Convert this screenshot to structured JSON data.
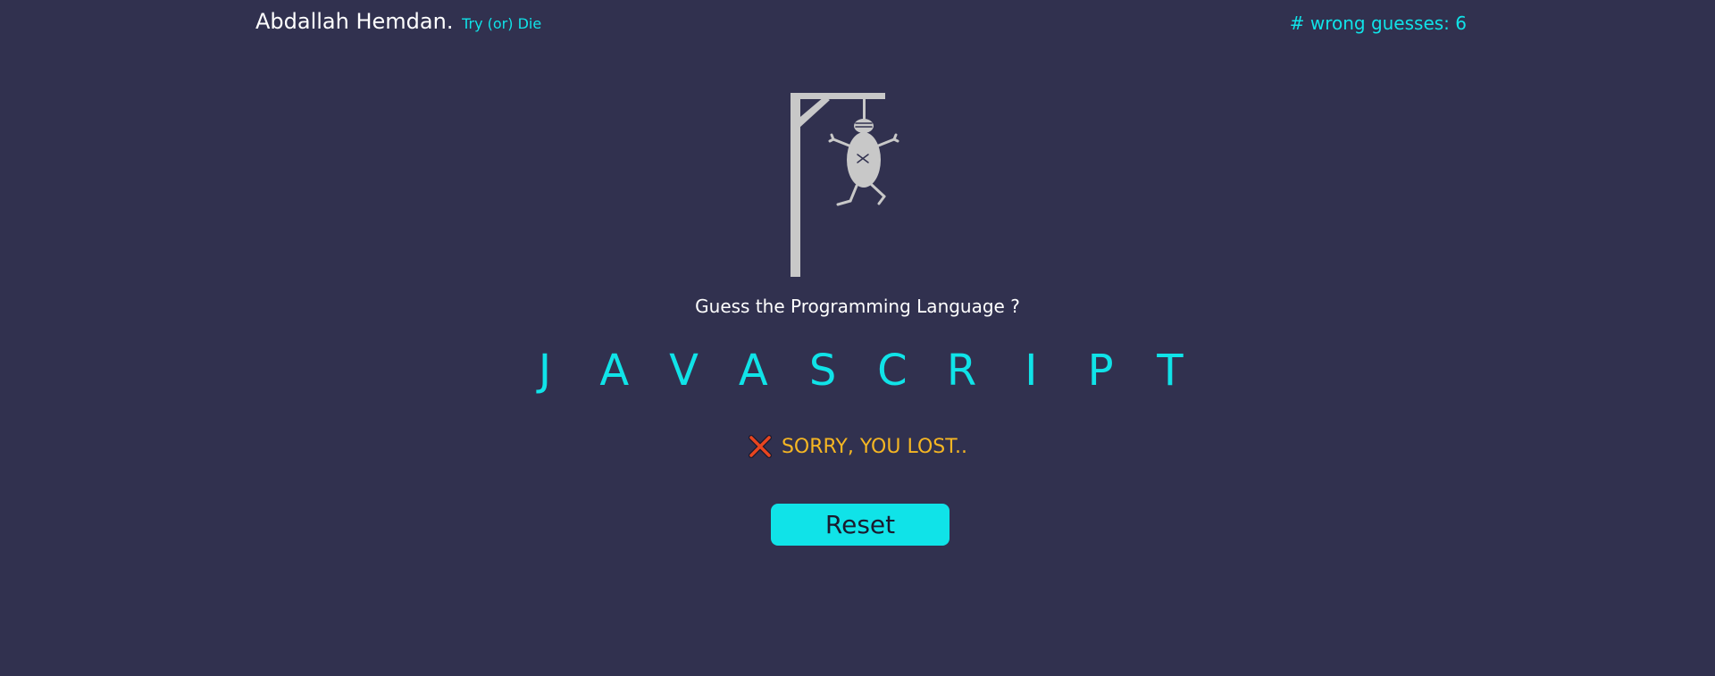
{
  "header": {
    "brand_name": "Abdallah Hemdan.",
    "tagline": "Try (or) Die",
    "wrong_guesses_label": "# wrong guesses: 6"
  },
  "game": {
    "prompt": "Guess the Programming Language ?",
    "letters": [
      "J",
      "A",
      "V",
      "A",
      "S",
      "C",
      "R",
      "I",
      "P",
      "T"
    ],
    "result_message": "SORRY, YOU LOST..",
    "reset_label": "Reset"
  },
  "colors": {
    "background": "#31314f",
    "accent": "#10e3e8",
    "loss_text": "#f5b623",
    "loss_icon": "#e8451f",
    "figure": "#c8c8c8"
  },
  "icons": {
    "hangman": "hangman-figure-icon",
    "result": "cross-icon"
  }
}
